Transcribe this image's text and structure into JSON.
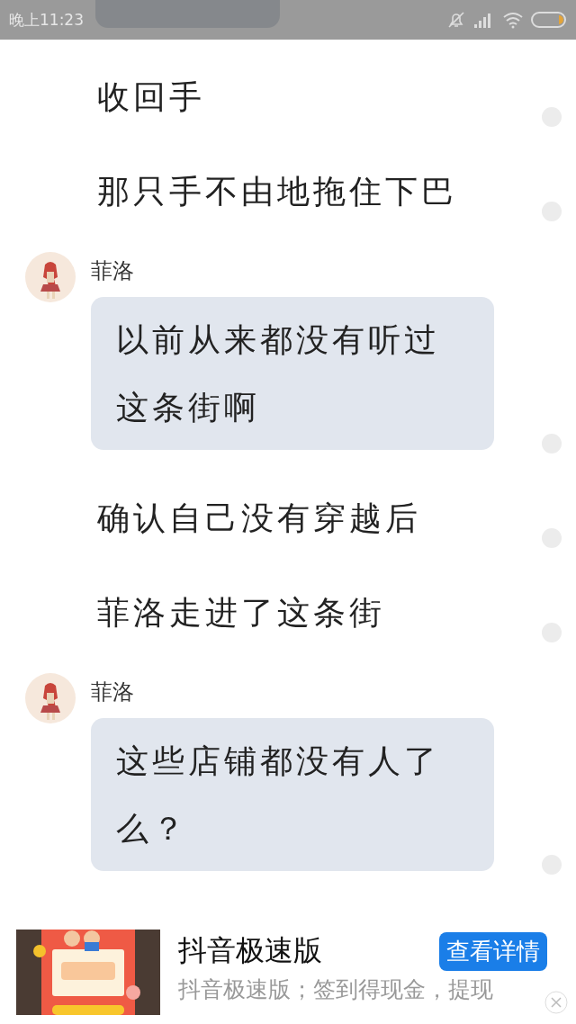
{
  "status_bar": {
    "time": "晚上11:23"
  },
  "items": [
    {
      "kind": "narration",
      "text": "收回手"
    },
    {
      "kind": "narration",
      "text": "那只手不由地拖住下巴"
    },
    {
      "kind": "message",
      "name": "菲洛",
      "text": "以前从来都没有听过这条街啊"
    },
    {
      "kind": "narration",
      "text": "确认自己没有穿越后"
    },
    {
      "kind": "narration",
      "text": "菲洛走进了这条街"
    },
    {
      "kind": "message",
      "name": "菲洛",
      "text": "这些店铺都没有人了么？"
    }
  ],
  "ad": {
    "title": "抖音极速版",
    "button": "查看详情",
    "description": "抖音极速版；签到得现金，提现"
  }
}
